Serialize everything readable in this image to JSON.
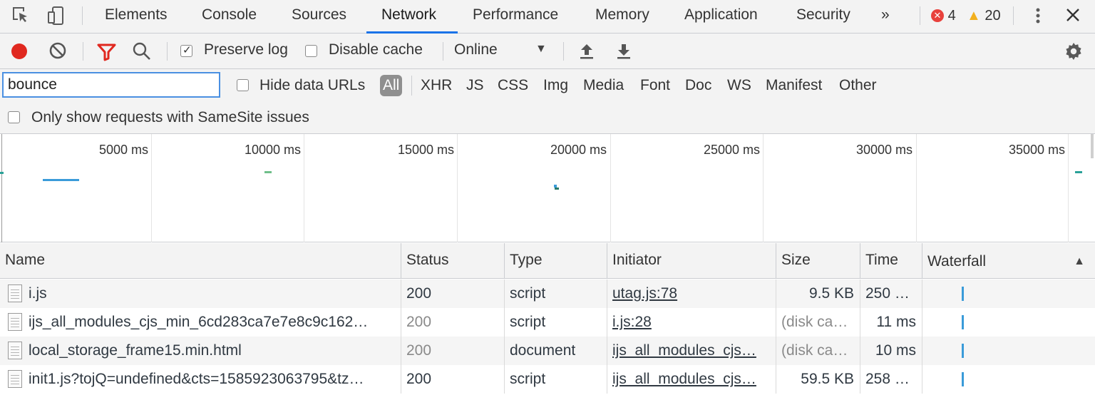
{
  "tabs": [
    "Elements",
    "Console",
    "Sources",
    "Network",
    "Performance",
    "Memory",
    "Application",
    "Security",
    "»"
  ],
  "active_tab": "Network",
  "badges": {
    "errors": "4",
    "warnings": "20"
  },
  "toolbar": {
    "preserve_log": "Preserve log",
    "disable_cache": "Disable cache",
    "throttling": "Online"
  },
  "filter": {
    "value": "bounce",
    "hide_data_urls": "Hide data URLs",
    "types": [
      "All",
      "XHR",
      "JS",
      "CSS",
      "Img",
      "Media",
      "Font",
      "Doc",
      "WS",
      "Manifest",
      "Other"
    ],
    "samesite": "Only show requests with SameSite issues"
  },
  "overview": {
    "ticks": [
      "5000 ms",
      "10000 ms",
      "15000 ms",
      "20000 ms",
      "25000 ms",
      "30000 ms",
      "35000 ms"
    ]
  },
  "columns": [
    "Name",
    "Status",
    "Type",
    "Initiator",
    "Size",
    "Time",
    "Waterfall"
  ],
  "rows": [
    {
      "name": "i.js",
      "status": "200",
      "type": "script",
      "initiator": "utag.js:78",
      "size": "9.5 KB",
      "time": "250 …"
    },
    {
      "name": "ijs_all_modules_cjs_min_6cd283ca7e7e8c9c162…",
      "status": "200",
      "type": "script",
      "initiator": "i.js:28",
      "size": "(disk ca…",
      "time": "11 ms"
    },
    {
      "name": "local_storage_frame15.min.html",
      "status": "200",
      "type": "document",
      "initiator": "ijs_all_modules_cjs…",
      "size": "(disk ca…",
      "time": "10 ms"
    },
    {
      "name": "init1.js?tojQ=undefined&cts=1585923063795&tz…",
      "status": "200",
      "type": "script",
      "initiator": "ijs_all_modules_cjs…",
      "size": "59.5 KB",
      "time": "258 …"
    }
  ],
  "colors": {
    "record": "#e0281f",
    "filter_icon": "#e0281f",
    "active_tab_underline": "#1a73e8",
    "waterfall": "#3a9bd9"
  }
}
